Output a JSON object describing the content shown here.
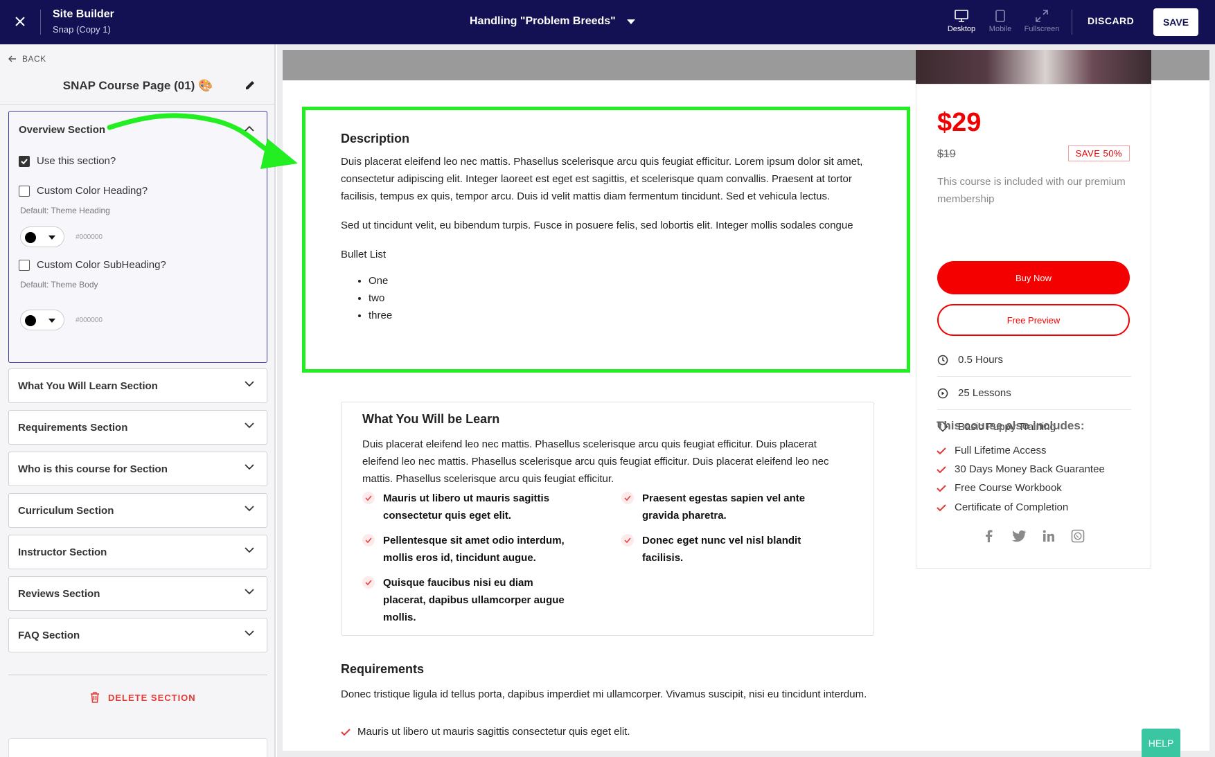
{
  "topbar": {
    "app_title": "Site Builder",
    "app_subtitle": "Snap (Copy 1)",
    "page_title": "Handling \"Problem Breeds\"",
    "views": {
      "desktop": "Desktop",
      "mobile": "Mobile",
      "fullscreen": "Fullscreen"
    },
    "discard": "DISCARD",
    "save": "SAVE"
  },
  "sidebar": {
    "back": "BACK",
    "page_name": "SNAP Course Page (01) 🎨",
    "overview": {
      "title": "Overview Section",
      "use_section": "Use this section?",
      "use_section_checked": true,
      "custom_heading": "Custom Color Heading?",
      "heading_default": "Default: Theme Heading",
      "heading_hex": "#000000",
      "custom_subheading": "Custom Color SubHeading?",
      "subheading_default": "Default: Theme Body",
      "subheading_hex": "#000000"
    },
    "sections": [
      "What You Will Learn Section",
      "Requirements Section",
      "Who is this course for Section",
      "Curriculum Section",
      "Instructor Section",
      "Reviews Section",
      "FAQ Section"
    ],
    "delete": "DELETE SECTION"
  },
  "preview": {
    "description": {
      "title": "Description",
      "p1": "Duis placerat eleifend leo nec mattis. Phasellus scelerisque arcu quis feugiat efficitur. Lorem ipsum dolor sit amet, consectetur adipiscing elit. Integer laoreet est eget est sagittis, et scelerisque quam convallis. Praesent at tortor facilisis, tempus ex quis, tempor arcu. Duis id velit mattis diam fermentum tincidunt. Sed et vehicula lectus.",
      "p2": "Sed ut tincidunt velit, eu bibendum turpis. Fusce in posuere felis, sed lobortis elit. Integer mollis sodales congue",
      "p3": "Bullet List",
      "bullets": [
        "One",
        "two",
        "three"
      ]
    },
    "learn": {
      "title": "What You Will be Learn",
      "intro": "Duis placerat eleifend leo nec mattis. Phasellus scelerisque arcu quis feugiat efficitur. Duis placerat eleifend leo nec mattis. Phasellus scelerisque arcu quis feugiat efficitur. Duis placerat eleifend leo nec mattis. Phasellus scelerisque arcu quis feugiat efficitur.",
      "items": [
        "Mauris ut libero ut mauris sagittis consectetur quis eget elit.",
        "Praesent egestas sapien vel ante gravida pharetra.",
        "Pellentesque sit amet odio interdum, mollis eros id, tincidunt augue.",
        "Donec eget nunc vel nisl blandit facilisis.",
        "Quisque faucibus nisi eu diam placerat, dapibus ullamcorper augue mollis."
      ]
    },
    "requirements": {
      "title": "Requirements",
      "text": "Donec tristique ligula id tellus porta, dapibus imperdiet mi ullamcorper. Vivamus suscipit, nisi eu tincidunt interdum.",
      "item": "Mauris ut libero ut mauris sagittis consectetur quis eget elit."
    },
    "card": {
      "price": "$29",
      "old_price": "$19",
      "save_badge": "SAVE 50%",
      "included": "This course is included with our premium membership",
      "buy": "Buy Now",
      "free_preview": "Free Preview",
      "hours": "0.5 Hours",
      "lessons": "25 Lessons",
      "category": "Basic Puppy Training",
      "also_title": "This course also includes:",
      "also_items": [
        "Full Lifetime Access",
        "30 Days Money Back Guarantee",
        "Free Course Workbook",
        "Certificate of Completion"
      ],
      "socials": [
        "facebook-icon",
        "twitter-icon",
        "linkedin-icon",
        "whatsapp-icon"
      ]
    }
  },
  "help": "HELP",
  "colors": {
    "navy": "#131153",
    "accent_red": "#f40000",
    "highlight_green": "#22ee22",
    "help_green": "#39c6a0"
  }
}
